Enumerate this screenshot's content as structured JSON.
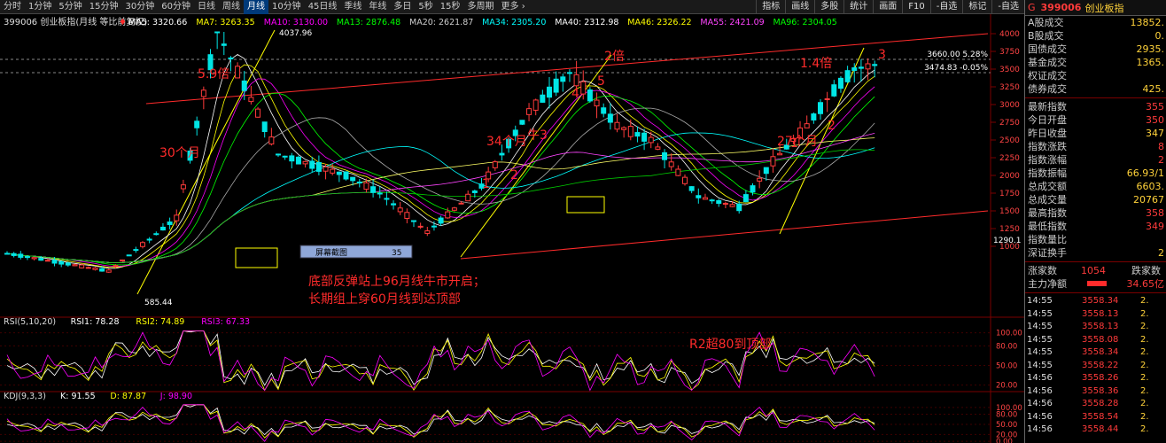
{
  "period_tabs": [
    "分时",
    "1分钟",
    "5分钟",
    "15分钟",
    "30分钟",
    "60分钟",
    "日线",
    "周线",
    "月线",
    "10分钟",
    "45日线",
    "季线",
    "年线",
    "多日",
    "5秒",
    "15秒",
    "多周期",
    "更多 ›"
  ],
  "active_tab": "月线",
  "right_buttons": [
    "指标",
    "画线",
    "多股",
    "统计",
    "画面",
    "F10",
    "-自选",
    "标记",
    "-自选"
  ],
  "title": "399006 创业板指(月线 等比前复权)",
  "ma_legend": [
    {
      "label": "MA5: 3320.66",
      "color": "#ffffff"
    },
    {
      "label": "MA7: 3263.35",
      "color": "#ffff00"
    },
    {
      "label": "MA10: 3130.00",
      "color": "#ff00ff"
    },
    {
      "label": "MA13: 2876.48",
      "color": "#00ff00"
    },
    {
      "label": "MA20: 2621.87",
      "color": "#cccccc"
    },
    {
      "label": "MA34: 2305.20",
      "color": "#00ffff"
    },
    {
      "label": "MA40: 2312.98",
      "color": "#ffffff"
    },
    {
      "label": "MA46: 2326.22",
      "color": "#ffff00"
    },
    {
      "label": "MA55: 2421.09",
      "color": "#ff44ff"
    },
    {
      "label": "MA96: 2304.05",
      "color": "#00ff00"
    }
  ],
  "price_axis": [
    "4000",
    "3750",
    "3500",
    "3250",
    "3000",
    "2750",
    "2500",
    "2250",
    "2000",
    "1750",
    "1500",
    "1250",
    "1000"
  ],
  "price_labels": {
    "high": "4037.96",
    "low": "585.44",
    "last": "1290.1",
    "r1": "3660.00 5.28%",
    "r2": "3474.83 -0.05%"
  },
  "annotations": {
    "t1": "5.9倍",
    "t2": "30个月",
    "t3": "2倍",
    "t4": "1.4倍",
    "t5": "3",
    "t6": "34个月",
    "t7": "牛3",
    "t8": "27个月",
    "t9": "2",
    "t10": "1",
    "t11": "2",
    "t12": "4",
    "t13": "5",
    "t14": "1",
    "t15": "1",
    "main1": "底部反弹站上96月线牛市开启；",
    "main2": "长期组上穿60月线到达顶部",
    "rsi_note": "R2超80到顶部"
  },
  "screenshot_label": "屏幕截图",
  "screenshot_num": "35",
  "rsi": {
    "header": "RSI(5,10,20)",
    "items": [
      {
        "label": "RSI1: 78.28",
        "color": "#ffffff"
      },
      {
        "label": "RSI2: 74.89",
        "color": "#ffff00"
      },
      {
        "label": "RSI3: 67.33",
        "color": "#ff00ff"
      }
    ],
    "axis": [
      "100.00",
      "80.00",
      "50.00",
      "20.00"
    ]
  },
  "kdj": {
    "header": "KDJ(9,3,3)",
    "items": [
      {
        "label": "K: 91.55",
        "color": "#ffffff"
      },
      {
        "label": "D: 87.87",
        "color": "#ffff00"
      },
      {
        "label": "J: 98.90",
        "color": "#ff00ff"
      }
    ],
    "axis": [
      "100.00",
      "80.00",
      "50.00",
      "20.00",
      "0.00"
    ]
  },
  "panel": {
    "code": "399006",
    "name": "创业板指",
    "stats": [
      {
        "k": "A股成交",
        "v": "13852."
      },
      {
        "k": "B股成交",
        "v": "0."
      },
      {
        "k": "国债成交",
        "v": "2935."
      },
      {
        "k": "基金成交",
        "v": "1365."
      },
      {
        "k": "权证成交",
        "v": ""
      },
      {
        "k": "债券成交",
        "v": "425."
      }
    ],
    "stats2": [
      {
        "k": "最新指数",
        "v": "355",
        "c": "r"
      },
      {
        "k": "今日开盘",
        "v": "350",
        "c": "r"
      },
      {
        "k": "昨日收盘",
        "v": "347",
        "c": ""
      },
      {
        "k": "指数涨跌",
        "v": "8",
        "c": "r"
      },
      {
        "k": "指数涨幅",
        "v": "2",
        "c": "r"
      },
      {
        "k": "指数振幅",
        "v": "66.93/1",
        "c": ""
      },
      {
        "k": "总成交额",
        "v": "6603.",
        "c": ""
      },
      {
        "k": "总成交量",
        "v": "20767",
        "c": ""
      },
      {
        "k": "最高指数",
        "v": "358",
        "c": "r"
      },
      {
        "k": "最低指数",
        "v": "349",
        "c": "r"
      },
      {
        "k": "指数量比",
        "v": "",
        "c": ""
      },
      {
        "k": "深证换手",
        "v": "2",
        "c": ""
      }
    ],
    "updown": {
      "up_label": "涨家数",
      "up": "1054",
      "down_label": "跌家数"
    },
    "flow": {
      "label": "主力净额",
      "value": "34.65亿"
    },
    "ticks": [
      {
        "t": "14:55",
        "p": "3558.34",
        "q": "2."
      },
      {
        "t": "14:55",
        "p": "3558.13",
        "q": "2."
      },
      {
        "t": "14:55",
        "p": "3558.13",
        "q": "2."
      },
      {
        "t": "14:55",
        "p": "3558.08",
        "q": "2."
      },
      {
        "t": "14:55",
        "p": "3558.34",
        "q": "2."
      },
      {
        "t": "14:55",
        "p": "3558.22",
        "q": "2."
      },
      {
        "t": "14:56",
        "p": "3558.26",
        "q": "2."
      },
      {
        "t": "14:56",
        "p": "3558.36",
        "q": "2."
      },
      {
        "t": "14:56",
        "p": "3558.28",
        "q": "2."
      },
      {
        "t": "14:56",
        "p": "3558.54",
        "q": "2."
      },
      {
        "t": "14:56",
        "p": "3558.44",
        "q": "2."
      }
    ]
  },
  "chart_data": {
    "type": "line",
    "title": "399006 创业板指(月线 等比前复权)",
    "series": [
      {
        "name": "创业板指",
        "x": [
          0,
          15,
          25,
          31,
          40,
          50,
          55,
          62,
          70,
          77,
          83,
          90,
          95,
          102,
          108,
          113,
          118,
          122,
          125,
          128
        ],
        "y": [
          900,
          650,
          1400,
          4037,
          2300,
          2000,
          1750,
          1200,
          1850,
          2900,
          3450,
          2700,
          2500,
          1700,
          1550,
          2200,
          2700,
          3200,
          3500,
          3558
        ]
      }
    ],
    "ylim": [
      1000,
      4000
    ]
  }
}
